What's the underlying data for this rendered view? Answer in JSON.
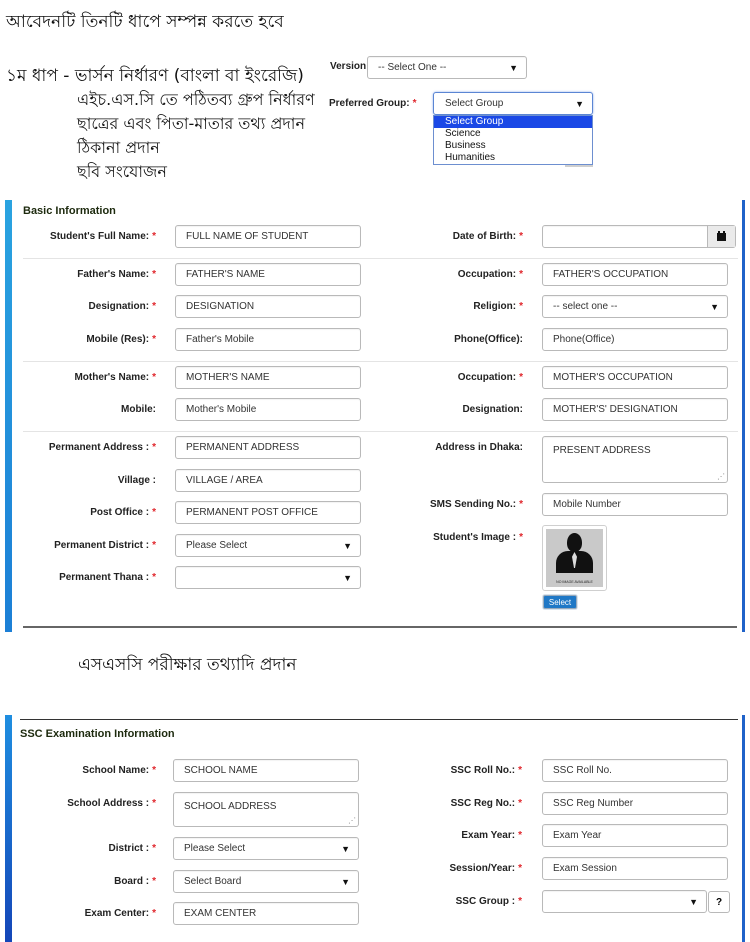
{
  "intro": {
    "title": "আবেদনটি তিনটি ধাপে সম্পন্ন করতে হবে",
    "step1": "১ম ধাপ - ভার্সন নির্ধারণ (বাংলা বা ইংরেজি)",
    "steps": [
      "এইচ.এস.সি তে পঠিতব্য গ্রুপ নির্ধারণ",
      "ছাত্রের এবং পিতা-মাতার তথ্য প্রদান",
      "ঠিকানা প্রদান",
      "ছবি সংযোজন"
    ]
  },
  "version": {
    "label": "Version:",
    "value": "-- Select One --"
  },
  "preferred_group": {
    "label": "Preferred Group:",
    "value": "Select Group",
    "options": [
      "Select Group",
      "Science",
      "Business",
      "Humanities"
    ],
    "highlighted": "Select Group"
  },
  "required_mark": "*",
  "basic": {
    "title": "Basic Information",
    "fields": {
      "student_name": {
        "label": "Student's Full Name:",
        "value": "FULL NAME OF STUDENT"
      },
      "dob": {
        "label": "Date of Birth:",
        "value": ""
      },
      "father_name": {
        "label": "Father's Name:",
        "value": "FATHER'S NAME"
      },
      "father_occupation": {
        "label": "Occupation:",
        "value": "FATHER'S OCCUPATION"
      },
      "father_designation": {
        "label": "Designation:",
        "value": "DESIGNATION"
      },
      "religion": {
        "label": "Religion:",
        "value": "-- select one --"
      },
      "father_mobile": {
        "label": "Mobile (Res):",
        "value": "Father's Mobile"
      },
      "phone_office": {
        "label": "Phone(Office):",
        "value": "Phone(Office)"
      },
      "mother_name": {
        "label": "Mother's Name:",
        "value": "MOTHER'S NAME"
      },
      "mother_occupation": {
        "label": "Occupation:",
        "value": "MOTHER'S OCCUPATION"
      },
      "mother_mobile": {
        "label": "Mobile:",
        "value": "Mother's Mobile"
      },
      "mother_designation": {
        "label": "Designation:",
        "value": "MOTHER'S' DESIGNATION"
      },
      "perm_address": {
        "label": "Permanent Address :",
        "value": "PERMANENT ADDRESS"
      },
      "address_dhaka": {
        "label": "Address in Dhaka:",
        "value": "PRESENT ADDRESS"
      },
      "village": {
        "label": "Village :",
        "value": "VILLAGE / AREA"
      },
      "post_office": {
        "label": "Post Office :",
        "value": "PERMANENT POST OFFICE"
      },
      "sms_no": {
        "label": "SMS Sending No.:",
        "value": "Mobile Number"
      },
      "perm_district": {
        "label": "Permanent District :",
        "value": "Please Select"
      },
      "student_image": {
        "label": "Student's Image :",
        "caption": "NO IMAGE AVAILABLE",
        "button": "Select"
      },
      "perm_thana": {
        "label": "Permanent Thana :",
        "value": ""
      }
    }
  },
  "ssc_intro": "এসএসসি পরীক্ষার তথ্যাদি প্রদান",
  "ssc": {
    "title": "SSC Examination Information",
    "fields": {
      "school_name": {
        "label": "School Name:",
        "value": "SCHOOL NAME"
      },
      "roll_no": {
        "label": "SSC Roll No.:",
        "value": "SSC Roll No."
      },
      "school_address": {
        "label": "School Address :",
        "value": "SCHOOL ADDRESS"
      },
      "reg_no": {
        "label": "SSC Reg No.:",
        "value": "SSC Reg Number"
      },
      "exam_year": {
        "label": "Exam Year:",
        "value": "Exam Year"
      },
      "district": {
        "label": "District :",
        "value": "Please Select"
      },
      "session": {
        "label": "Session/Year:",
        "value": "Exam Session"
      },
      "board": {
        "label": "Board :",
        "value": "Select Board"
      },
      "group": {
        "label": "SSC Group :",
        "value": "",
        "help": "?"
      },
      "exam_center": {
        "label": "Exam Center:",
        "value": "EXAM CENTER"
      }
    }
  },
  "icons": {
    "dropdown_arrow": "▼",
    "resize_grip": "⋰"
  }
}
